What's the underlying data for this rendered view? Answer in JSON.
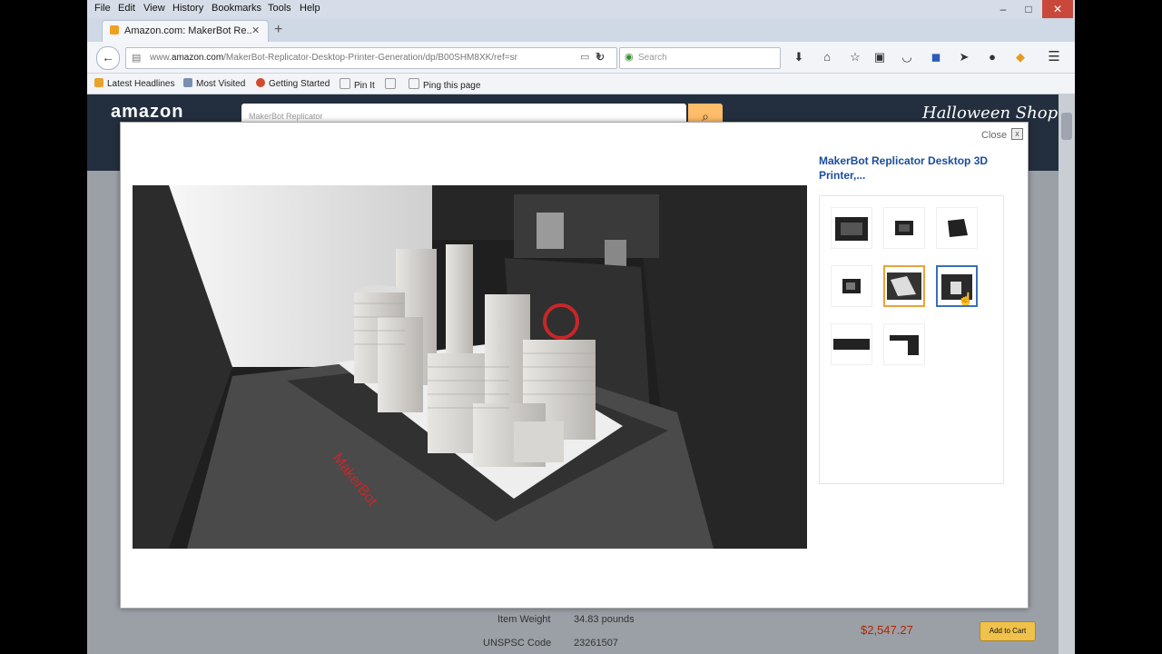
{
  "browser": {
    "menu": [
      "File",
      "Edit",
      "View",
      "History",
      "Bookmarks",
      "Tools",
      "Help"
    ],
    "tab_title": "Amazon.com: MakerBot Re...",
    "url_prefix": "www.",
    "url_domain": "amazon.com",
    "url_path": "/MakerBot-Replicator-Desktop-Printer-Generation/dp/B00SHM8XK/ref=sr",
    "search_placeholder": "Search",
    "bookmarks": [
      "Latest Headlines",
      "Most Visited",
      "Getting Started",
      "Pin It",
      "Ping this page"
    ]
  },
  "amazon": {
    "logo": "amazon",
    "search_hint": "MakerBot Replicator",
    "promo": "Halloween Shop",
    "specs": [
      {
        "label": "Item Weight",
        "value": "34.83 pounds"
      },
      {
        "label": "UNSPSC Code",
        "value": "23261507"
      }
    ],
    "price": "$2,547.27",
    "add_to_cart": "Add to Cart"
  },
  "modal": {
    "close_label": "Close",
    "close_x": "x",
    "product_title": "MakerBot Replicator Desktop 3D Printer,...",
    "thumbnails": [
      {
        "id": "printer-front",
        "selected": false
      },
      {
        "id": "printer-small",
        "selected": false
      },
      {
        "id": "printer-angle",
        "selected": false
      },
      {
        "id": "printer-side",
        "selected": false
      },
      {
        "id": "build-plate",
        "selected": "orange"
      },
      {
        "id": "city-print",
        "selected": "blue"
      },
      {
        "id": "printer-wide",
        "selected": false
      },
      {
        "id": "printer-arm",
        "selected": false
      }
    ],
    "printer_brand_text": "MakerBot",
    "colors": {
      "title_blue": "#1a4c9c",
      "orange": "#e8a33d",
      "blue": "#3b6fb6",
      "amazon_dark": "#232f3e"
    }
  }
}
